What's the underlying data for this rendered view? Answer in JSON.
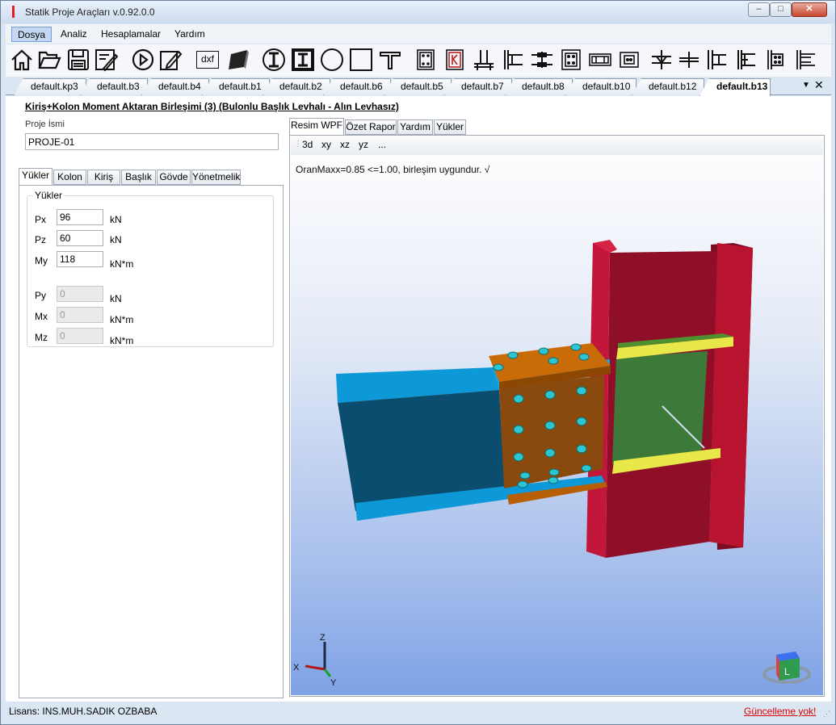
{
  "window": {
    "title": "Statik Proje Araçları v.0.92.0.0",
    "min": "–",
    "max": "□",
    "close": "✕"
  },
  "menu": [
    "Dosya",
    "Analiz",
    "Hesaplamalar",
    "Yardım"
  ],
  "toolbar_icons": [
    "home-icon",
    "open-folder-icon",
    "save-icon",
    "settings-doc-icon",
    "run-icon",
    "edit-icon",
    "dxf-icon",
    "plate-3d-icon",
    "circle-i-section-icon",
    "boxed-i-section-icon",
    "circle-section-icon",
    "square-section-icon",
    "t-section-icon",
    "bolt-plate-icon",
    "k-plate-icon",
    "base-plate-icon",
    "end-plate-icon",
    "beam-splice-icon",
    "bolt-group-icon",
    "cover-plate-icon",
    "web-splice-icon",
    "column-splice-icon",
    "flange-splice-icon",
    "beam-column-icon",
    "moment-conn-icon",
    "stiffener-icon",
    "double-conn-icon"
  ],
  "toolbar_dxf": "dxf",
  "doc_tabs": [
    "default.kp3",
    "default.b3",
    "default.b4",
    "default.b1",
    "default.b2",
    "default.b6",
    "default.b5",
    "default.b7",
    "default.b8",
    "default.b10",
    "default.b12",
    "default.b13"
  ],
  "page_title": "Kiriş+Kolon Moment Aktaran Birleşimi (3) (Bulonlu Başlık Levhalı - Alın Levhasız)",
  "project": {
    "label": "Proje İsmi",
    "value": "PROJE-01"
  },
  "left_tabs": [
    "Yükler",
    "Kolon",
    "Kiriş",
    "Başlık",
    "Gövde",
    "Yönetmelik"
  ],
  "loads": {
    "legend": "Yükler",
    "rows": [
      {
        "label": "Px",
        "value": "96",
        "unit": "kN",
        "enabled": true
      },
      {
        "label": "Pz",
        "value": "60",
        "unit": "kN",
        "enabled": true
      },
      {
        "label": "My",
        "value": "118",
        "unit": "kN*m",
        "enabled": true
      },
      {
        "label": "Py",
        "value": "0",
        "unit": "kN",
        "enabled": false
      },
      {
        "label": "Mx",
        "value": "0",
        "unit": "kN*m",
        "enabled": false
      },
      {
        "label": "Mz",
        "value": "0",
        "unit": "kN*m",
        "enabled": false
      }
    ]
  },
  "right_tabs": [
    "Resim WPF",
    "Özet Rapor",
    "Yardım",
    "Yükler"
  ],
  "view_buttons": [
    "3d",
    "xy",
    "xz",
    "yz",
    "..."
  ],
  "result_text": "OranMaxx=0.85 <=1.00, birleşim uygundur. √",
  "axes": {
    "x": "X",
    "y": "Y",
    "z": "Z"
  },
  "status": {
    "license": "Lisans: INS.MUH.SADIK OZBABA",
    "update": "Güncelleme yok!"
  },
  "colors": {
    "column": "#a8102c",
    "beam": "#0d99d8",
    "beam_web": "#0a4d6e",
    "plate": "#b75f05",
    "stiffener": "#e8e84a",
    "panel": "#3d7a3a",
    "bolt": "#2ec4d0"
  }
}
